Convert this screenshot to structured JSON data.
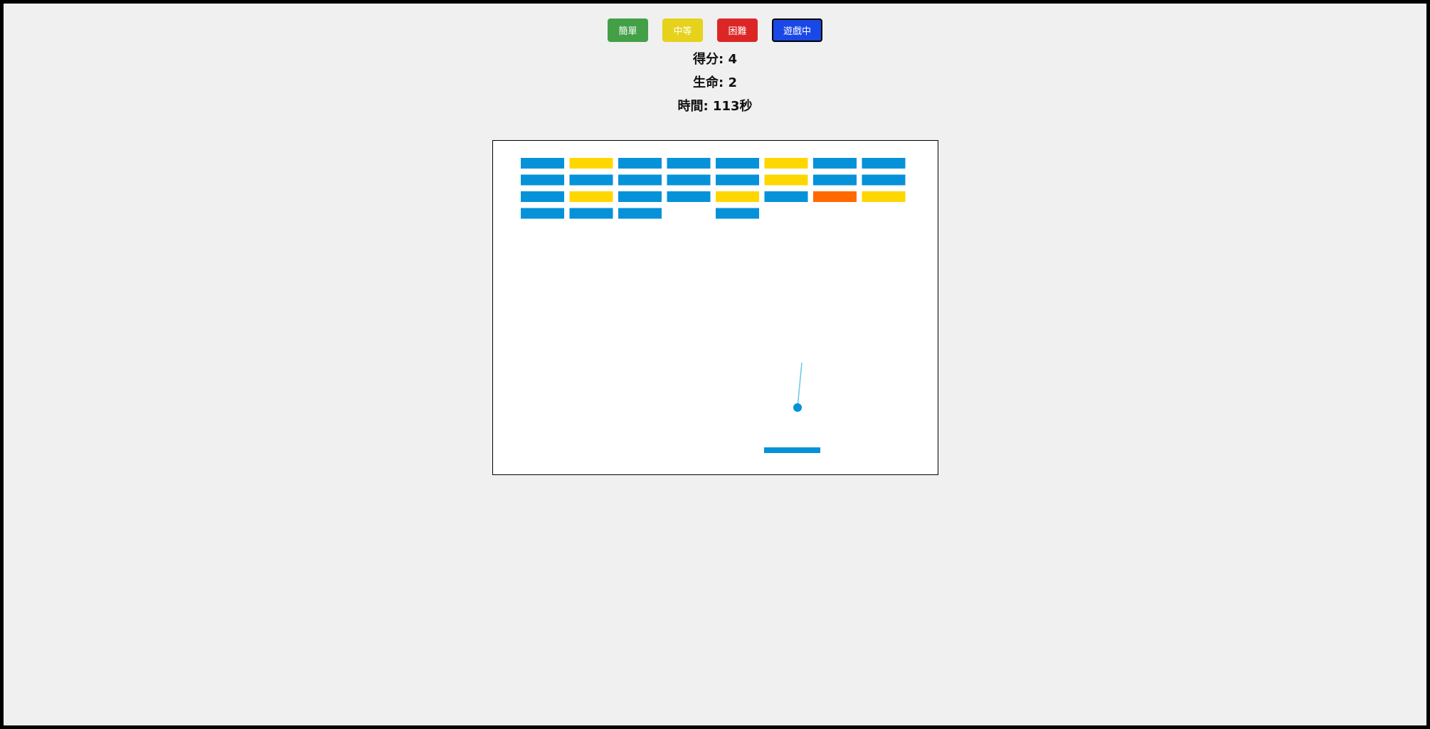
{
  "buttons": {
    "easy": "簡單",
    "medium": "中等",
    "hard": "困難",
    "playing": "遊戲中"
  },
  "hud": {
    "score_label": "得分: 4",
    "lives_label": "生命: 2",
    "time_label": "時間: 113秒"
  },
  "colors": {
    "blue": "#0592d8",
    "yellow": "#ffd700",
    "orange": "#ff6a00",
    "aim_line": "#6ac7e6"
  },
  "board": {
    "brick_grid": [
      [
        "blue",
        "yellow",
        "blue",
        "blue",
        "blue",
        "yellow",
        "blue",
        "blue"
      ],
      [
        "blue",
        "blue",
        "blue",
        "blue",
        "blue",
        "yellow",
        "blue",
        "blue"
      ],
      [
        "blue",
        "yellow",
        "blue",
        "blue",
        "yellow",
        "blue",
        "orange",
        "yellow"
      ],
      [
        "blue",
        "blue",
        "blue",
        null,
        "blue",
        null,
        null,
        null
      ]
    ]
  }
}
